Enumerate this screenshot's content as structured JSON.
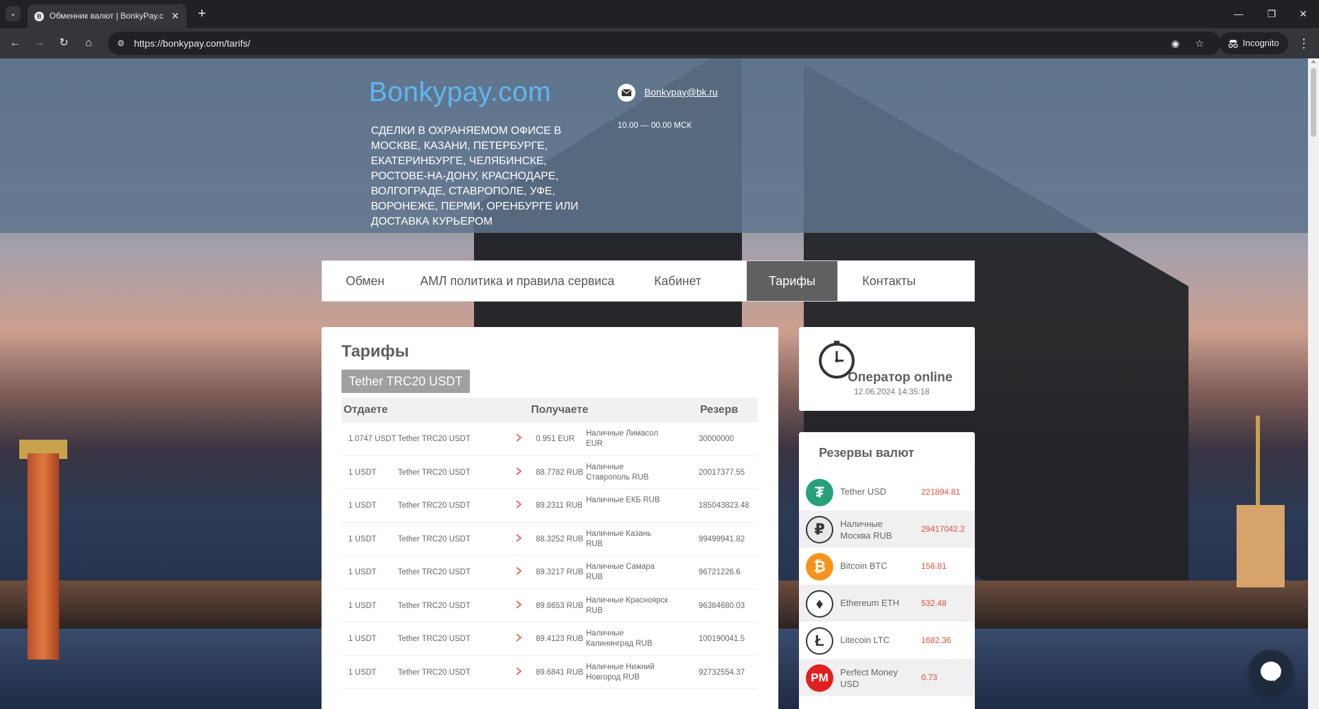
{
  "browser": {
    "tab_title": "Обменник валют | BonkyPay.com",
    "url": "https://bonkypay.com/tarifs/",
    "incognito_label": "Incognito"
  },
  "header": {
    "logo": "Bonkypay.com",
    "tagline": "Сделки в охраняемом офисе в Москве, Казани, Петербурге, Екатеринбурге, Челябинске, Ростове-на-Дону, Краснодаре, Волгограде, Ставрополе, Уфе, Воронеже, Перми, Оренбурге или доставка курьером",
    "email": "Bonkypay@bk.ru",
    "hours": "10.00 — 00.00  МСК"
  },
  "nav": {
    "items": [
      {
        "label": "Обмен"
      },
      {
        "label": "АМЛ политика и правила сервиса"
      },
      {
        "label": "Кабинет"
      },
      {
        "label": "Тарифы"
      },
      {
        "label": "Контакты"
      }
    ],
    "active": "Тарифы"
  },
  "tariffs": {
    "title": "Тарифы",
    "currency_button": "Tether TRC20 USDT",
    "columns": [
      "Отдаете",
      "Получаете",
      "Резерв"
    ],
    "rows": [
      {
        "give_amount": "1.0747 USDT",
        "give_currency": "Tether TRC20 USDT",
        "get_amount": "0.951 EUR",
        "get_currency": "Наличные Лимасол EUR",
        "reserve": "30000000"
      },
      {
        "give_amount": "1 USDT",
        "give_currency": "Tether TRC20 USDT",
        "get_amount": "88.7782 RUB",
        "get_currency": "Наличные Ставрополь RUB",
        "reserve": "20017377.55"
      },
      {
        "give_amount": "1 USDT",
        "give_currency": "Tether TRC20 USDT",
        "get_amount": "89.2311 RUB",
        "get_currency": "Наличные ЕКБ RUB",
        "reserve": "185043823.48"
      },
      {
        "give_amount": "1 USDT",
        "give_currency": "Tether TRC20 USDT",
        "get_amount": "88.3252 RUB",
        "get_currency": "Наличные Казань RUB",
        "reserve": "99499941.82"
      },
      {
        "give_amount": "1 USDT",
        "give_currency": "Tether TRC20 USDT",
        "get_amount": "89.3217 RUB",
        "get_currency": "Наличные Самара RUB",
        "reserve": "96721226.6"
      },
      {
        "give_amount": "1 USDT",
        "give_currency": "Tether TRC20 USDT",
        "get_amount": "89.8653 RUB",
        "get_currency": "Наличные Красноярск RUB",
        "reserve": "96384680.03"
      },
      {
        "give_amount": "1 USDT",
        "give_currency": "Tether TRC20 USDT",
        "get_amount": "89.4123 RUB",
        "get_currency": "Наличные Калининград RUB",
        "reserve": "100190041.5"
      },
      {
        "give_amount": "1 USDT",
        "give_currency": "Tether TRC20 USDT",
        "get_amount": "89.6841 RUB",
        "get_currency": "Наличные Нижний Новгород RUB",
        "reserve": "92732554.37"
      }
    ]
  },
  "operator": {
    "title": "Оператор online",
    "datetime": "12.06.2024 14:35:18"
  },
  "reserves": {
    "title": "Резервы валют",
    "items": [
      {
        "name": "Tether USD",
        "value": "221894.81",
        "icon": "tether-icon",
        "color": "#26a17b",
        "glyph": "₮"
      },
      {
        "name": "Наличные Москва RUB",
        "value": "29417042.2",
        "icon": "cash-rub-icon",
        "color": "#e8e8e8",
        "glyph": "₽"
      },
      {
        "name": "Bitcoin BTC",
        "value": "158.81",
        "icon": "bitcoin-icon",
        "color": "#f7931a",
        "glyph": "₿"
      },
      {
        "name": "Ethereum ETH",
        "value": "532.48",
        "icon": "ethereum-icon",
        "color": "#ffffff",
        "glyph": "♦"
      },
      {
        "name": "Litecoin LTC",
        "value": "1682.36",
        "icon": "litecoin-icon",
        "color": "#ffffff",
        "glyph": "Ł"
      },
      {
        "name": "Perfect Money USD",
        "value": "0.73",
        "icon": "perfect-money-icon",
        "color": "#e02020",
        "glyph": "PM"
      }
    ]
  }
}
